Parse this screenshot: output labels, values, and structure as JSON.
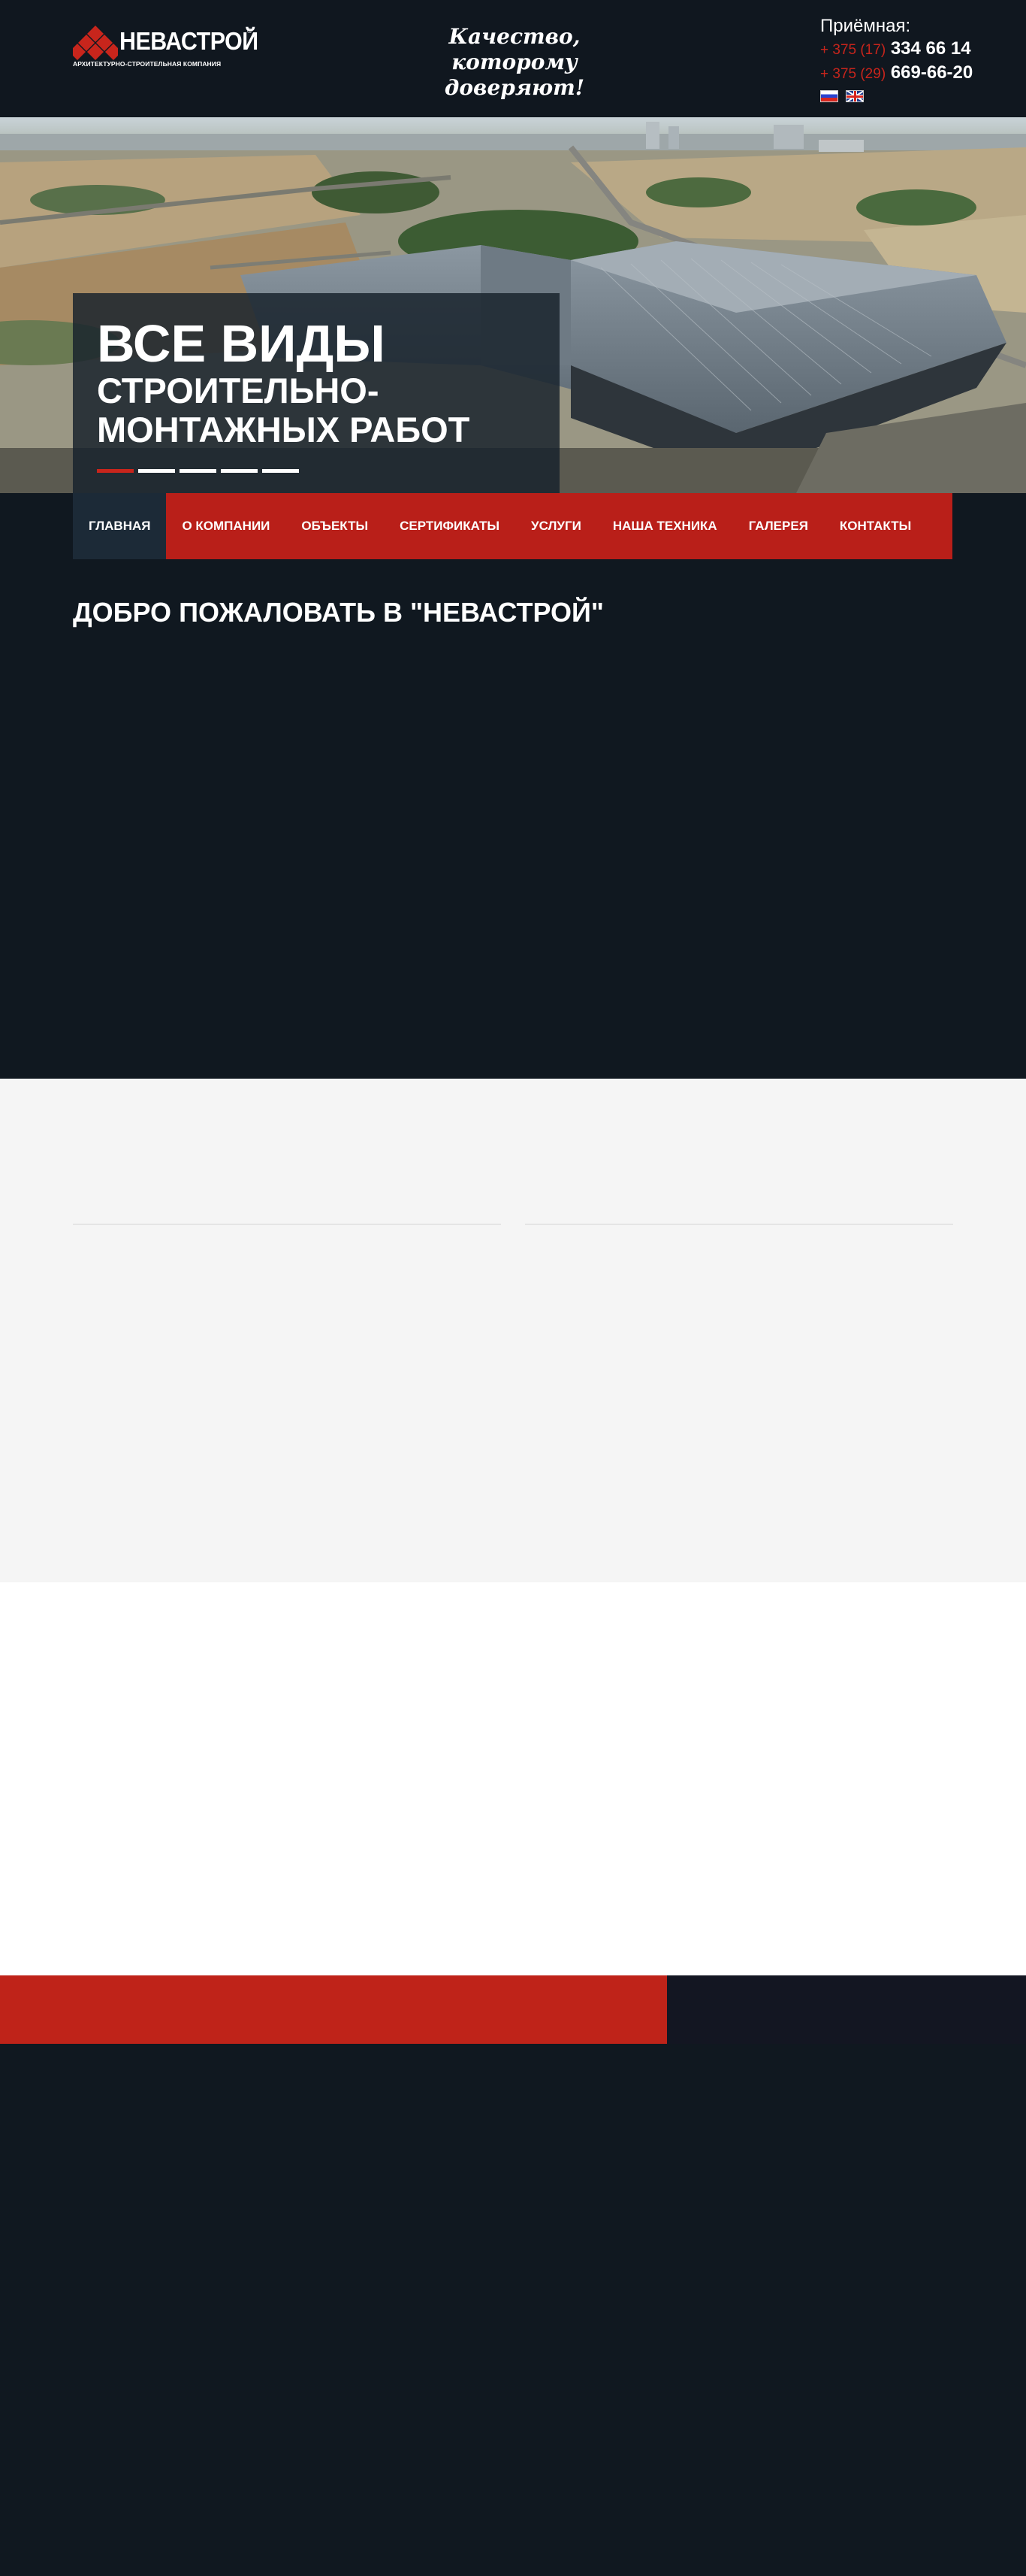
{
  "header": {
    "logo_name": "НЕВАСТРОЙ",
    "logo_reg": "®",
    "logo_subtitle": "АРХИТЕКТУРНО-СТРОИТЕЛЬНАЯ КОМПАНИЯ",
    "slogan_line1": "Качество,",
    "slogan_line2": "которому доверяют!",
    "reception_label": "Приёмная:",
    "phones": [
      {
        "code": "+ 375 (17)",
        "number": "334 66 14"
      },
      {
        "code": "+ 375 (29)",
        "number": "669-66-20"
      }
    ],
    "languages": [
      "ru",
      "en"
    ]
  },
  "hero": {
    "title_line1": "ВСЕ ВИДЫ",
    "title_line2": "СТРОИТЕЛЬНО-",
    "title_line3": "МОНТАЖНЫХ РАБОТ",
    "slide_count": 5,
    "active_slide": 1
  },
  "nav": {
    "items": [
      {
        "label": "ГЛАВНАЯ",
        "active": true
      },
      {
        "label": "О КОМПАНИИ",
        "active": false
      },
      {
        "label": "ОБЪЕКТЫ",
        "active": false
      },
      {
        "label": "СЕРТИФИКАТЫ",
        "active": false
      },
      {
        "label": "УСЛУГИ",
        "active": false
      },
      {
        "label": "НАША ТЕХНИКА",
        "active": false
      },
      {
        "label": "ГАЛЕРЕЯ",
        "active": false
      },
      {
        "label": "КОНТАКТЫ",
        "active": false
      }
    ]
  },
  "main": {
    "welcome_title": "ДОБРО ПОЖАЛОВАТЬ В \"НЕВАСТРОЙ\""
  },
  "colors": {
    "brand_red": "#b91f19",
    "nav_active": "#1c2a37",
    "page_dark": "#101820",
    "light_section": "#f5f5f5"
  }
}
